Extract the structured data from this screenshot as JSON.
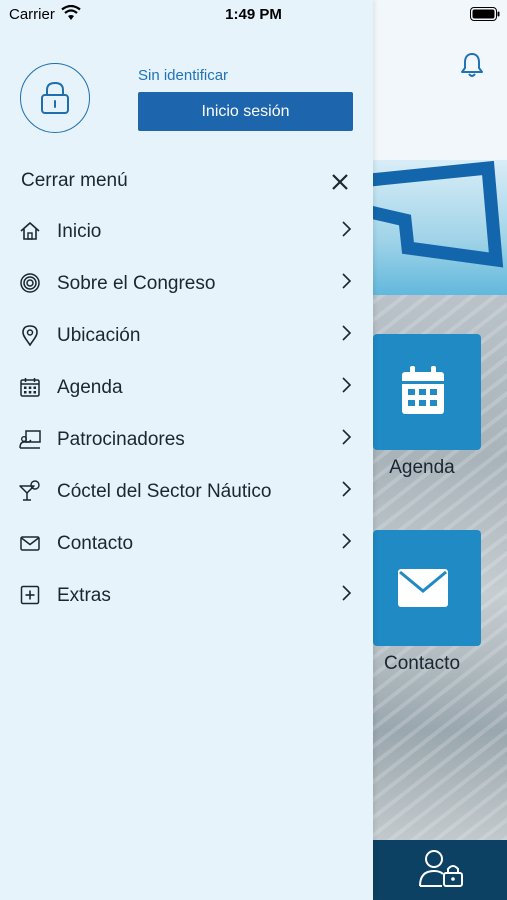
{
  "status_bar": {
    "carrier": "Carrier",
    "time": "1:49 PM"
  },
  "drawer": {
    "user_status": "Sin identificar",
    "login_label": "Inicio sesión",
    "close_label": "Cerrar menú",
    "items": [
      {
        "label": "Inicio",
        "icon": "home-icon"
      },
      {
        "label": "Sobre el Congreso",
        "icon": "target-icon"
      },
      {
        "label": "Ubicación",
        "icon": "map-pin-icon"
      },
      {
        "label": "Agenda",
        "icon": "calendar-icon"
      },
      {
        "label": "Patrocinadores",
        "icon": "sponsors-icon"
      },
      {
        "label": "Cóctel del Sector Náutico",
        "icon": "cocktail-icon"
      },
      {
        "label": "Contacto",
        "icon": "mail-icon"
      },
      {
        "label": "Extras",
        "icon": "plus-square-icon"
      }
    ]
  },
  "background": {
    "tiles": [
      {
        "label": "Agenda",
        "icon": "calendar-icon"
      },
      {
        "label": "Contacto",
        "icon": "mail-icon"
      }
    ]
  },
  "colors": {
    "accent": "#1d66ad",
    "drawer_bg": "#e6f3fb",
    "tile": "#1f8ac4",
    "bottom_bar": "#0c4163"
  }
}
